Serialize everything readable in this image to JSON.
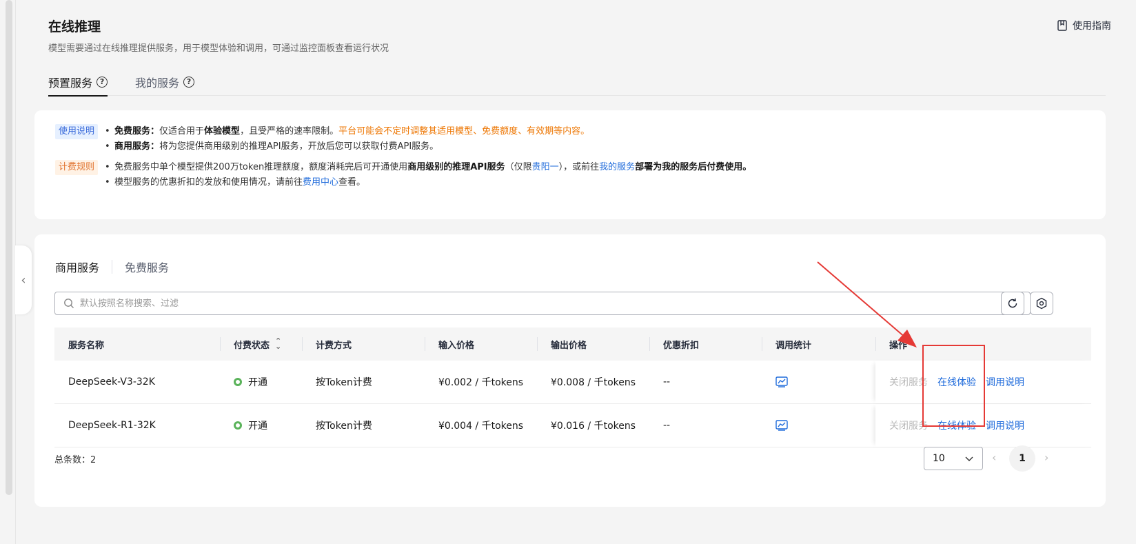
{
  "page": {
    "title": "在线推理",
    "description": "模型需要通过在线推理提供服务，用于模型体验和调用，可通过监控面板查看运行状况",
    "guide_label": "使用指南"
  },
  "top_tabs": [
    {
      "label": "预置服务",
      "active": true
    },
    {
      "label": "我的服务",
      "active": false
    }
  ],
  "info": {
    "usage_tag": "使用说明",
    "usage_line1_bold": "免费服务：",
    "usage_line1_a": "仅适合用于",
    "usage_line1_bold2": "体验模型",
    "usage_line1_b": "，且受严格的速率限制。",
    "usage_line1_orange": "平台可能会不定时调整其适用模型、免费额度、有效期等内容。",
    "usage_line2_bold": "商用服务：",
    "usage_line2_text": "将为您提供商用级别的推理API服务，开放后您可以获取付费API服务。",
    "billing_tag": "计费规则",
    "billing_line1_a": "免费服务中单个模型提供200万token推理额度，额度消耗完后可开通使用",
    "billing_line1_bold": "商用级别的推理API服务",
    "billing_line1_b": "（仅限",
    "billing_line1_link1": "贵阳一",
    "billing_line1_c": "），或前往",
    "billing_line1_link2": "我的服务",
    "billing_line1_bold2": "部署为我的服务后付费使用。",
    "billing_line2_a": "模型服务的优惠折扣的发放和使用情况，请前往",
    "billing_line2_link": "费用中心",
    "billing_line2_b": "查看。"
  },
  "sub_tabs": [
    {
      "label": "商用服务",
      "active": true
    },
    {
      "label": "免费服务",
      "active": false
    }
  ],
  "search": {
    "placeholder": "默认按照名称搜索、过滤"
  },
  "table": {
    "headers": [
      "服务名称",
      "付费状态",
      "计费方式",
      "输入价格",
      "输出价格",
      "优惠折扣",
      "调用统计",
      "操作"
    ],
    "rows": [
      {
        "name": "DeepSeek-V3-32K",
        "status": "开通",
        "billing": "按Token计费",
        "input_price": "¥0.002 / 千tokens",
        "output_price": "¥0.008 / 千tokens",
        "discount": "--",
        "op_close": "关闭服务",
        "op_try": "在线体验",
        "op_doc": "调用说明"
      },
      {
        "name": "DeepSeek-R1-32K",
        "status": "开通",
        "billing": "按Token计费",
        "input_price": "¥0.004 / 千tokens",
        "output_price": "¥0.016 / 千tokens",
        "discount": "--",
        "op_close": "关闭服务",
        "op_try": "在线体验",
        "op_doc": "调用说明"
      }
    ]
  },
  "pagination": {
    "total_label": "总条数：2",
    "page_size": "10",
    "current_page": "1"
  },
  "colors": {
    "accent": "#1f6bdb",
    "status_green": "#5bb35b",
    "annotation_red": "#e53935",
    "warning_orange": "#ed7500"
  }
}
